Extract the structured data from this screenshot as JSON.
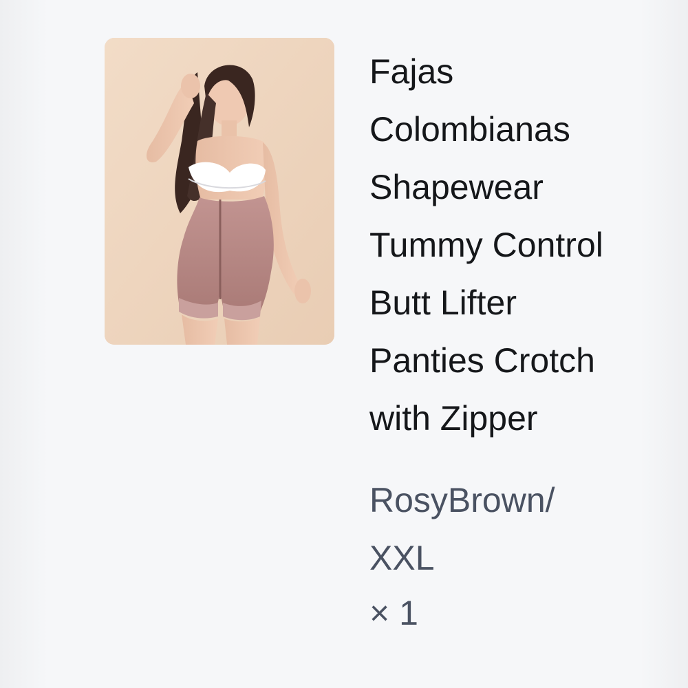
{
  "order_item": {
    "image_icon": "product-photo-shapewear-model",
    "title": "Fajas Colombianas Shapewear Tummy Control Butt Lifter Panties Crotch with Zipper",
    "variant": "RosyBrown/ XXL",
    "quantity": "× 1"
  },
  "colors": {
    "background": "#f6f7f9",
    "title_text": "#15171a",
    "meta_text": "#4a5262",
    "product_color": "#b98a86"
  }
}
